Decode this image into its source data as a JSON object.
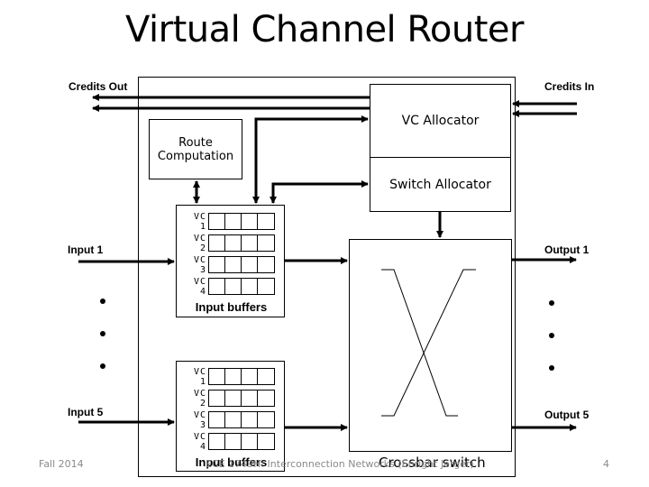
{
  "title": "Virtual Channel Router",
  "labels": {
    "credits_out": "Credits Out",
    "credits_in": "Credits In",
    "input_1": "Input 1",
    "input_5": "Input 5",
    "output_1": "Output 1",
    "output_5": "Output 5"
  },
  "blocks": {
    "route_computation": "Route Computation",
    "vc_allocator": "VC Allocator",
    "switch_allocator": "Switch Allocator",
    "crossbar_switch": "Crossbar switch"
  },
  "input_buffers": [
    {
      "label": "Input buffers",
      "vcs": [
        "VC 1",
        "VC 2",
        "VC 3",
        "VC 4"
      ],
      "slots_per_vc": 4
    },
    {
      "label": "Input buffers",
      "vcs": [
        "VC 1",
        "VC 2",
        "VC 3",
        "VC 4"
      ],
      "slots_per_vc": 4
    }
  ],
  "footer": {
    "left": "Fall 2014",
    "center": "ECE 1749H: Interconnection Networks (Enright Jerger)",
    "page": "4"
  }
}
